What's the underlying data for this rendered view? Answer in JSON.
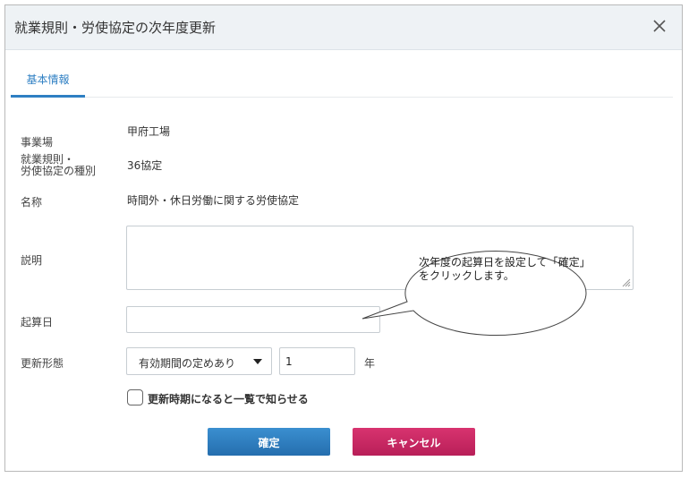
{
  "dialog": {
    "title": "就業規則・労使協定の次年度更新",
    "close_icon": "close-icon"
  },
  "tabs": [
    {
      "label": "基本情報",
      "active": true
    }
  ],
  "fields": {
    "office_label": "事業場",
    "office_value": "甲府工場",
    "type_label": "就業規則・\n労使協定の種別",
    "type_value": "36協定",
    "name_label": "名称",
    "name_value": "時間外・休日労働に関する労使協定",
    "description_label": "説明",
    "description_value": "",
    "start_date_label": "起算日",
    "start_date_value": "",
    "renewal_label": "更新形態",
    "renewal_option": "有効期間の定めあり",
    "renewal_number": "1",
    "renewal_unit": "年"
  },
  "notify": {
    "label": "更新時期になると一覧で知らせる",
    "checked": false
  },
  "buttons": {
    "confirm": "確定",
    "cancel": "キャンセル"
  },
  "callout": {
    "text": "次年度の起算日を設定して「確定」をクリックします。"
  },
  "colors": {
    "accent": "#2e7fc3",
    "confirm": "#2a79bd",
    "cancel": "#c8266a",
    "header_bg": "#eef2f5"
  }
}
